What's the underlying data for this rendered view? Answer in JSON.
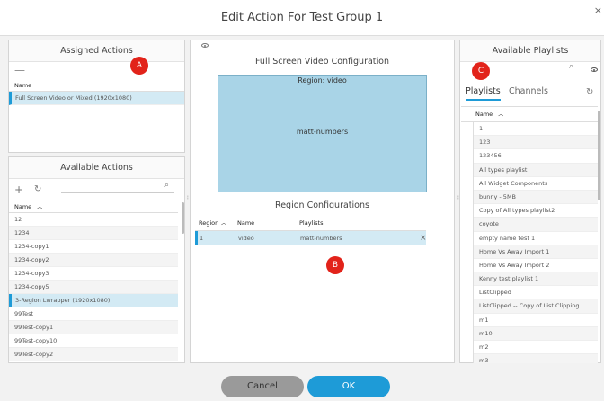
{
  "dialog": {
    "title": "Edit Action For Test Group 1",
    "close": "×"
  },
  "markers": {
    "a": "A",
    "b": "B",
    "c": "C"
  },
  "assigned": {
    "title": "Assigned Actions",
    "col": "Name",
    "rows": [
      "Full Screen Video or Mixed (1920x1080)"
    ]
  },
  "available_actions": {
    "title": "Available Actions",
    "col": "Name",
    "rows": [
      "12",
      "1234",
      "1234-copy1",
      "1234-copy2",
      "1234-copy3",
      "1234-copy5",
      "3-Region Lwrapper (1920x1080)",
      "99Test",
      "99Test-copy1",
      "99Test-copy10",
      "99Test-copy2"
    ]
  },
  "center": {
    "title": "Full Screen Video Configuration",
    "region_label": "Region: video",
    "region_content": "matt-numbers",
    "region_config_title": "Region Configurations",
    "table_headers": [
      "Region",
      "Name",
      "Playlists"
    ],
    "table_row": {
      "region": "1",
      "name": "video",
      "playlists": "matt-numbers",
      "remove": "×"
    }
  },
  "playlists": {
    "title": "Available Playlists",
    "tab_playlists": "Playlists",
    "tab_channels": "Channels",
    "col": "Name",
    "rows": [
      "1",
      "123",
      "123456",
      "All types playlist",
      "All Widget Components",
      "bunny - 5MB",
      "Copy of All types playlist2",
      "coyote",
      "empty name test 1",
      "Home Vs Away Import 1",
      "Home Vs Away Import 2",
      "Kenny test playlist 1",
      "ListClipped",
      "ListClipped -- Copy of List Clipping",
      "m1",
      "m10",
      "m2",
      "m3"
    ]
  },
  "buttons": {
    "cancel": "Cancel",
    "ok": "OK"
  },
  "colors": {
    "accent": "#1e9bd7",
    "marker": "#e2231a",
    "region": "#a9d4e7"
  }
}
